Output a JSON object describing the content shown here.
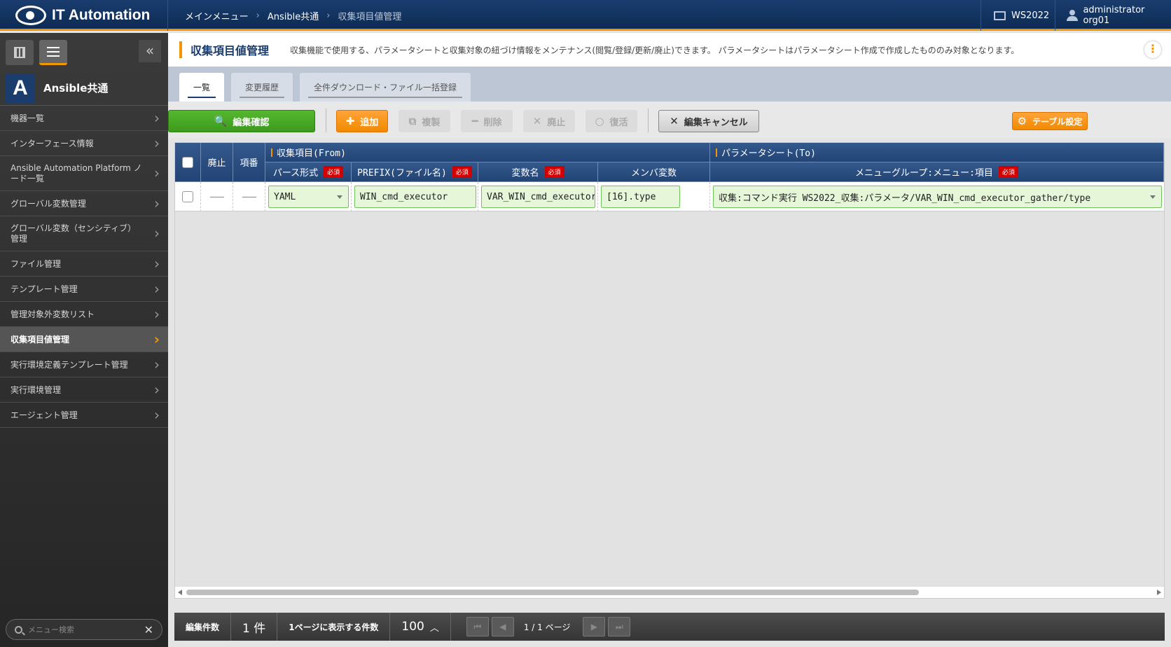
{
  "header": {
    "app_title": "IT Automation",
    "breadcrumb": [
      "メインメニュー",
      "Ansible共通",
      "収集項目値管理"
    ],
    "workspace": "WS2022",
    "user": "administrator org01"
  },
  "sidebar": {
    "menu_group": "Ansible共通",
    "logo_letter": "A",
    "items": [
      {
        "label": "機器一覧"
      },
      {
        "label": "インターフェース情報"
      },
      {
        "label": "Ansible Automation Platform ノード一覧"
      },
      {
        "label": "グローバル変数管理"
      },
      {
        "label": "グローバル変数（センシティブ）管理"
      },
      {
        "label": "ファイル管理"
      },
      {
        "label": "テンプレート管理"
      },
      {
        "label": "管理対象外変数リスト"
      },
      {
        "label": "収集項目値管理"
      },
      {
        "label": "実行環境定義テンプレート管理"
      },
      {
        "label": "実行環境管理"
      },
      {
        "label": "エージェント管理"
      }
    ],
    "active_index": 8,
    "search_placeholder": "メニュー検索"
  },
  "page": {
    "title": "収集項目値管理",
    "description": "収集機能で使用する、パラメータシートと収集対象の紐づけ情報をメンテナンス(閲覧/登録/更新/廃止)できます。 パラメータシートはパラメータシート作成で作成したもののみ対象となります。"
  },
  "tabs": [
    "一覧",
    "変更履歴",
    "全件ダウンロード・ファイル一括登録"
  ],
  "toolbar": {
    "edit_confirm": "編集確認",
    "add": "追加",
    "copy": "複製",
    "delete": "削除",
    "discard": "廃止",
    "restore": "復活",
    "edit_cancel": "編集キャンセル",
    "table_settings": "テーブル設定"
  },
  "table": {
    "col_discard": "廃止",
    "col_no": "項番",
    "group_from": "収集項目(From)",
    "group_to": "パラメータシート(To)",
    "col_parse": "パース形式",
    "col_prefix": "PREFIX(ファイル名)",
    "col_var": "変数名",
    "col_member": "メンバ変数",
    "col_menu": "メニューグループ:メニュー:項目",
    "required": "必須",
    "row": {
      "parse": "YAML",
      "prefix": "WIN_cmd_executor",
      "var": "VAR_WIN_cmd_executor",
      "member": "[16].type",
      "menu": "収集:コマンド実行 WS2022_収集:パラメータ/VAR_WIN_cmd_executor_gather/type"
    }
  },
  "footer": {
    "edit_count_label": "編集件数",
    "edit_count": "1 件",
    "per_page_label": "1ページに表示する件数",
    "per_page": "100",
    "page_info": "1 / 1 ページ"
  }
}
